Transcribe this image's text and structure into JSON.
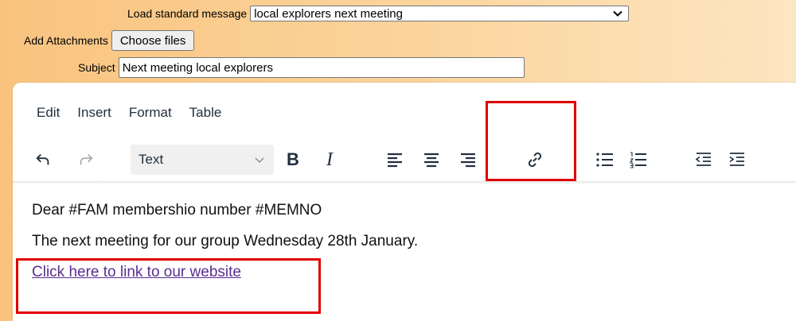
{
  "form": {
    "load_label": "Load standard message",
    "load_value": "local explorers next meeting",
    "attach_label": "Add Attachments",
    "attach_button": "Choose files",
    "subject_label": "Subject",
    "subject_value": "Next meeting local explorers"
  },
  "editor": {
    "menu": [
      "Edit",
      "Insert",
      "Format",
      "Table"
    ],
    "block_format": "Text",
    "toolbar_icons": [
      "undo-icon",
      "redo-icon",
      "bold-icon",
      "italic-icon",
      "align-left-icon",
      "align-center-icon",
      "align-right-icon",
      "link-icon",
      "bullet-list-icon",
      "numbered-list-icon",
      "outdent-icon",
      "indent-icon"
    ],
    "bold_glyph": "B",
    "italic_glyph": "I",
    "content": {
      "line1": "Dear #FAM  membershio number #MEMNO",
      "line2": "The next meeting for our group Wednesday 28th January.",
      "link_text": "Click here to link to our website"
    }
  },
  "colors": {
    "header_gradient_start": "#f9c37e",
    "header_gradient_end": "#fde6c2",
    "highlight": "#e00000",
    "link": "#5b2d91",
    "icon": "#222f3e"
  }
}
